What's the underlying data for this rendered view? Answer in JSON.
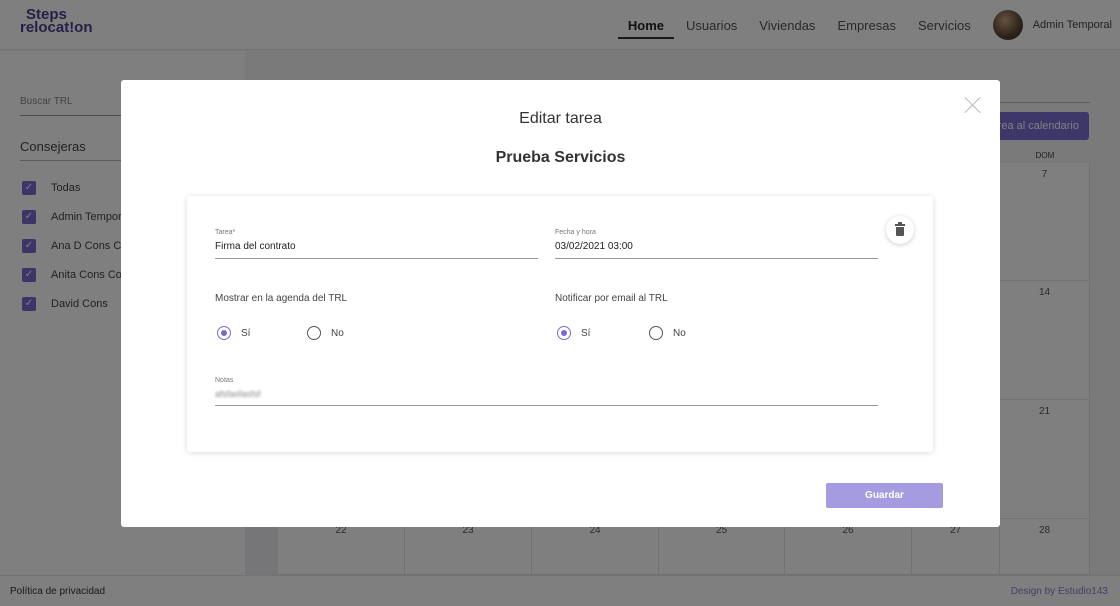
{
  "logo": {
    "line1": "Steps",
    "line2": "relocat!on"
  },
  "nav": {
    "items": [
      "Home",
      "Usuarios",
      "Viviendas",
      "Empresas",
      "Servicios"
    ],
    "active": "Home",
    "user_name": "Admin Temporal"
  },
  "sidebar": {
    "search_placeholder": "Buscar TRL",
    "consejeras_title": "Consejeras",
    "items": [
      "Todas",
      "Admin Temporal",
      "Ana D Cons Co",
      "Anita Cons Con",
      "David Cons"
    ]
  },
  "calendar": {
    "add_button": "Añadir tarea al calendario",
    "day_header": "DOM",
    "week1": [
      "",
      "",
      "",
      "",
      "",
      "",
      "7"
    ],
    "week2": [
      "",
      "",
      "",
      "",
      "",
      "",
      "14"
    ],
    "week3": [
      "",
      "",
      "",
      "",
      "",
      "",
      "21"
    ],
    "week4": [
      "22",
      "23",
      "24",
      "25",
      "26",
      "27",
      "28"
    ]
  },
  "modal": {
    "title": "Editar tarea",
    "subtitle": "Prueba Servicios",
    "tarea_label": "Tarea*",
    "tarea_value": "Firma del contrato",
    "fecha_label": "Fecha y hora",
    "fecha_value": "03/02/2021 03:00",
    "mostrar_label": "Mostrar en la agenda del TRL",
    "notificar_label": "Notificar por email al TRL",
    "option_yes": "Sí",
    "option_no": "No",
    "mostrar_selected": "Sí",
    "notificar_selected": "Sí",
    "notas_label": "Notas",
    "notas_value": "afsfasfasfsf",
    "save_button": "Guardar"
  },
  "footer": {
    "privacy": "Política de privacidad",
    "design": "Design by Estudio143"
  },
  "colors": {
    "accent": "#7a6bd1",
    "button": "#a59be0",
    "brand": "#4a3f8f"
  }
}
